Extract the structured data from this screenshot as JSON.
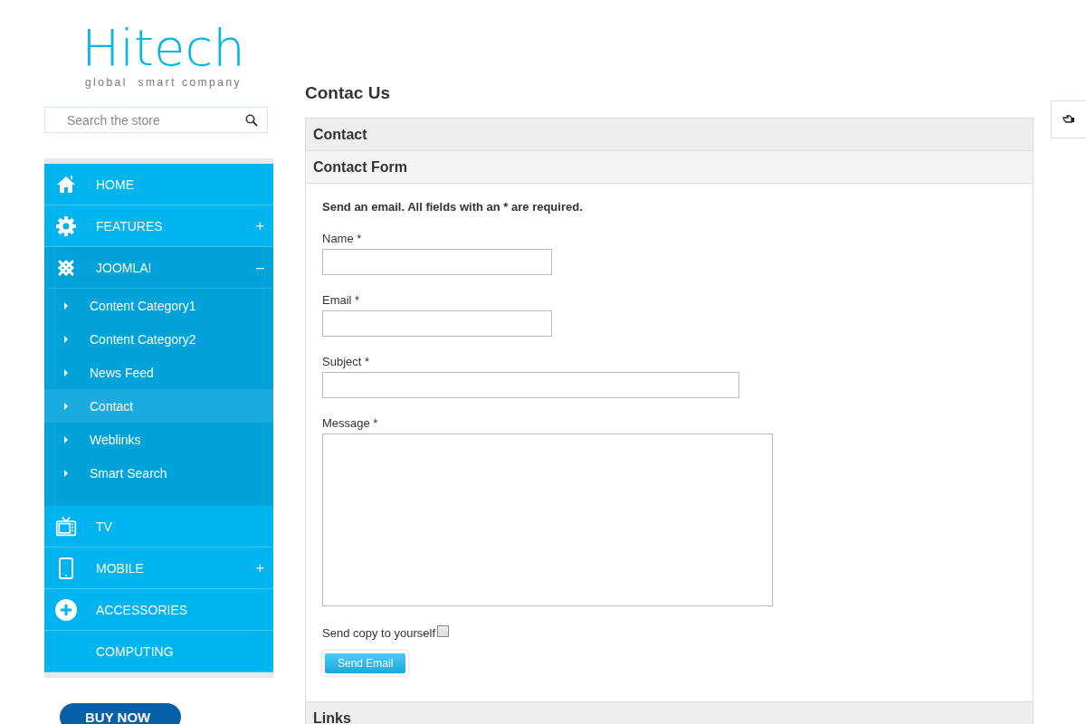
{
  "logo": {
    "name": "Hitech",
    "tagline": "global  smart company"
  },
  "search": {
    "placeholder": "Search the store"
  },
  "menu": [
    {
      "label": "HOME",
      "expanded": false
    },
    {
      "label": "FEATURES",
      "toggle": "+",
      "expanded": false
    },
    {
      "label": "JOOMLA!",
      "toggle": "–",
      "expanded": true,
      "children": [
        {
          "label": "Content Category1",
          "selected": false
        },
        {
          "label": "Content Category2",
          "selected": false
        },
        {
          "label": "News Feed",
          "selected": false
        },
        {
          "label": "Contact",
          "selected": true
        },
        {
          "label": "Weblinks",
          "selected": false
        },
        {
          "label": "Smart Search",
          "selected": false
        }
      ]
    },
    {
      "label": "TV",
      "expanded": false
    },
    {
      "label": "MOBILE",
      "toggle": "+",
      "expanded": false
    },
    {
      "label": "ACCESSORIES",
      "expanded": false
    },
    {
      "label": "COMPUTING",
      "expanded": false
    }
  ],
  "buy_button": "BUY NOW",
  "page_title": "Contac Us",
  "sections": [
    {
      "title": "Contact"
    },
    {
      "title": "Contact Form"
    }
  ],
  "form": {
    "intro": "Send an email. All fields with an * are required.",
    "fields": [
      {
        "label": "Name *",
        "kind": "short"
      },
      {
        "label": "Email *",
        "kind": "short"
      },
      {
        "label": "Subject *",
        "kind": "long"
      },
      {
        "label": "Message *",
        "kind": "area"
      }
    ],
    "copy": {
      "label": "Send copy to yourself",
      "checked": false
    },
    "submit": "Send Email"
  },
  "footer_section": {
    "title": "Links"
  }
}
